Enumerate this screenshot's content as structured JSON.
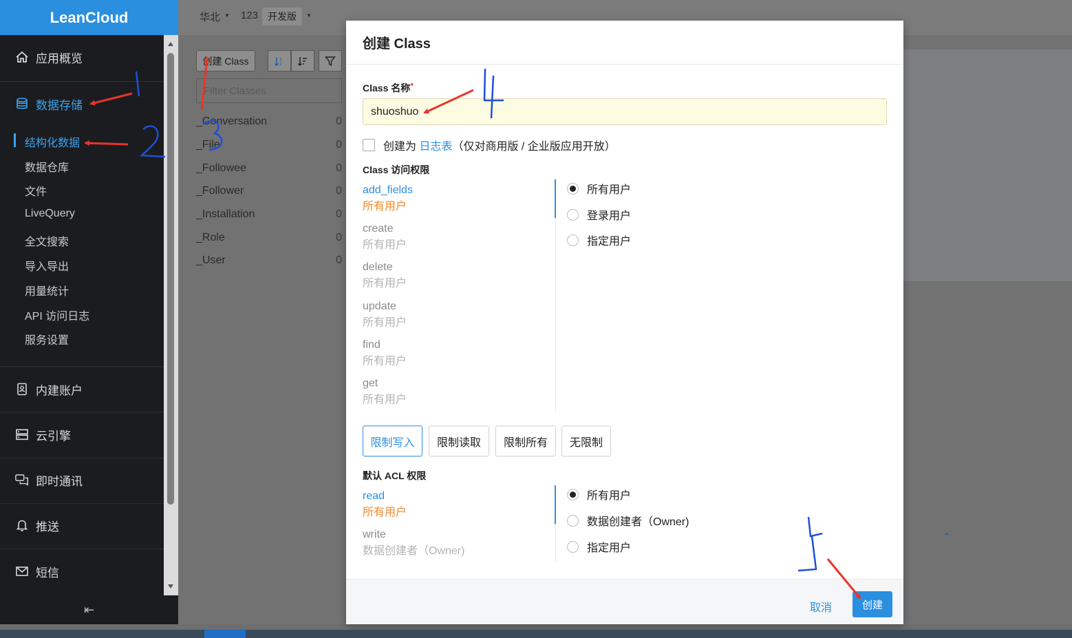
{
  "sidebar": {
    "brand": "LeanCloud",
    "nav": [
      {
        "label": "应用概览",
        "icon": "home-icon"
      },
      {
        "label": "数据存储",
        "icon": "database-icon"
      },
      {
        "label": "内建账户",
        "icon": "contact-card-icon"
      },
      {
        "label": "云引擎",
        "icon": "server-icon"
      },
      {
        "label": "即时通讯",
        "icon": "chat-icon"
      },
      {
        "label": "推送",
        "icon": "bell-icon"
      },
      {
        "label": "短信",
        "icon": "mail-icon"
      }
    ],
    "sub_items": [
      "结构化数据",
      "数据仓库",
      "文件",
      "LiveQuery",
      "全文搜索",
      "导入导出",
      "用量统计",
      "API 访问日志",
      "服务设置"
    ],
    "collapse_glyph": "⇤"
  },
  "topbar": {
    "region": "华北",
    "app": "123",
    "plan": "开发版"
  },
  "classes_panel": {
    "create_button": "创建 Class",
    "filter_placeholder": "Filter Classes",
    "classes": [
      {
        "name": "_Conversation",
        "count": "0"
      },
      {
        "name": "_File",
        "count": "0"
      },
      {
        "name": "_Followee",
        "count": "0"
      },
      {
        "name": "_Follower",
        "count": "0"
      },
      {
        "name": "_Installation",
        "count": "0"
      },
      {
        "name": "_Role",
        "count": "0"
      },
      {
        "name": "_User",
        "count": "0"
      }
    ]
  },
  "modal": {
    "title": "创建 Class",
    "name_label": "Class 名称",
    "required_mark": "*",
    "name_value": "shuoshuo",
    "log_checkbox": {
      "prefix": "创建为 ",
      "link": "日志表",
      "suffix": "（仅对商用版 / 企业版应用开放）"
    },
    "access_title": "Class 访问权限",
    "permissions": [
      {
        "name": "add_fields",
        "value": "所有用户"
      },
      {
        "name": "create",
        "value": "所有用户"
      },
      {
        "name": "delete",
        "value": "所有用户"
      },
      {
        "name": "update",
        "value": "所有用户"
      },
      {
        "name": "find",
        "value": "所有用户"
      },
      {
        "name": "get",
        "value": "所有用户"
      }
    ],
    "access_options": [
      "所有用户",
      "登录用户",
      "指定用户"
    ],
    "presets": [
      "限制写入",
      "限制读取",
      "限制所有",
      "无限制"
    ],
    "acl_title": "默认 ACL 权限",
    "acl": [
      {
        "name": "read",
        "value": "所有用户"
      },
      {
        "name": "write",
        "value": "数据创建者（Owner)"
      }
    ],
    "acl_options": [
      "所有用户",
      "数据创建者（Owner)",
      "指定用户"
    ],
    "cancel": "取消",
    "create": "创建"
  },
  "colors": {
    "accent": "#2b8fe0",
    "warning": "#f0882a",
    "annotation_red": "#e8352b",
    "annotation_blue": "#1e4fd8"
  }
}
